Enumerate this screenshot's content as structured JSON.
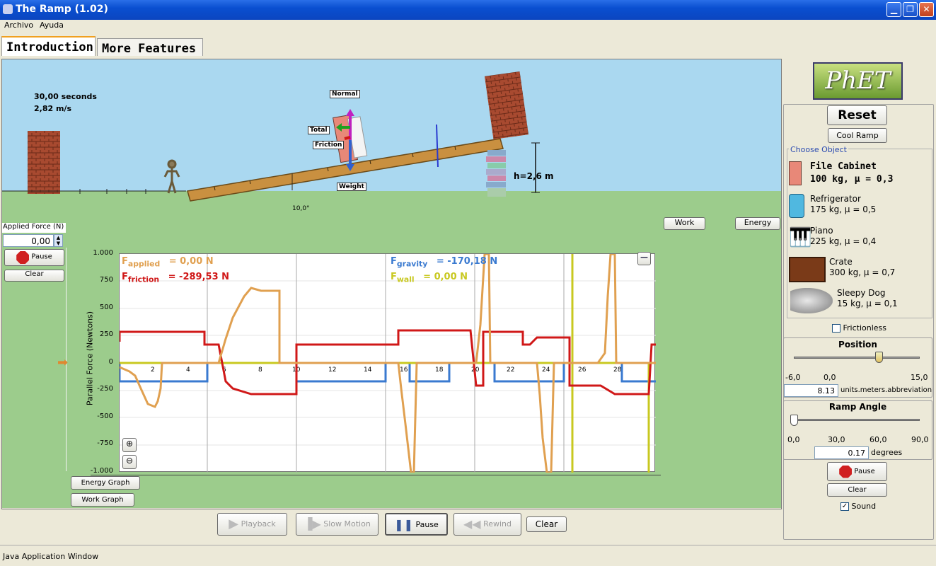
{
  "window": {
    "title": "The Ramp (1.02)",
    "min": "▁",
    "max": "❐",
    "close": "✕"
  },
  "menu": {
    "file": "Archivo",
    "help": "Ayuda"
  },
  "tabs": [
    {
      "label": "Introduction"
    },
    {
      "label": "More Features"
    }
  ],
  "scene": {
    "time": "30,00 seconds",
    "speed": "2,82 m/s",
    "labels": {
      "normal": "Normal",
      "total": "Total",
      "friction": "Friction",
      "weight": "Weight"
    },
    "angle_label": "10,0°",
    "height_label": "h=2,6 m",
    "work_button": "Work",
    "energy_button": "Energy"
  },
  "applied_force": {
    "label": "Applied Force (N)",
    "value": "0,00",
    "pause": "Pause",
    "clear": "Clear"
  },
  "graph": {
    "ylabel": "Parallel Force (Newtons)",
    "yticks": [
      "1.000",
      "750",
      "500",
      "250",
      "0",
      "-250",
      "-500",
      "-750",
      "-1.000"
    ],
    "xticks": [
      "2",
      "4",
      "6",
      "8",
      "10",
      "12",
      "14",
      "16",
      "18",
      "20",
      "22",
      "24",
      "26",
      "28"
    ],
    "f_applied": {
      "sym": "F",
      "sub": "applied",
      "val": "= 0,00 N"
    },
    "f_friction": {
      "sym": "F",
      "sub": "friction",
      "val": "= -289,53 N"
    },
    "f_gravity": {
      "sym": "F",
      "sub": "gravity",
      "val": "= -170,18 N"
    },
    "f_wall": {
      "sym": "F",
      "sub": "wall",
      "val": "= 0,00 N"
    },
    "minimize": "—",
    "energy_graph": "Energy Graph",
    "work_graph": "Work Graph"
  },
  "colors": {
    "applied": "#e0a050",
    "friction": "#d01818",
    "gravity": "#3a7ad0",
    "wall": "#c8c820"
  },
  "playback": {
    "playback": "Playback",
    "slow": "Slow Motion",
    "pause": "Pause",
    "rewind": "Rewind",
    "clear": "Clear"
  },
  "right": {
    "logo": "PhET",
    "reset": "Reset",
    "cool_ramp": "Cool Ramp",
    "choose_object": "Choose Object",
    "objects": [
      {
        "name": "File Cabinet",
        "desc": "100 kg, μ = 0,3",
        "icon": "file-cabinet-icon"
      },
      {
        "name": "Refrigerator",
        "desc": "175 kg, μ = 0,5",
        "icon": "refrigerator-icon"
      },
      {
        "name": "Piano",
        "desc": "225 kg, μ = 0,4",
        "icon": "piano-icon"
      },
      {
        "name": "Crate",
        "desc": "300 kg, μ = 0,7",
        "icon": "crate-icon"
      },
      {
        "name": "Sleepy Dog",
        "desc": "15 kg, μ = 0,1",
        "icon": "dog-icon"
      }
    ],
    "frictionless": "Frictionless",
    "position": {
      "title": "Position",
      "min": "-6,0",
      "mid": "0,0",
      "max": "15,0",
      "value": "8.13",
      "unit": "units.meters.abbreviation"
    },
    "ramp_angle": {
      "title": "Ramp Angle",
      "t0": "0,0",
      "t1": "30,0",
      "t2": "60,0",
      "t3": "90,0",
      "value": "0.17",
      "unit": "degrees"
    },
    "pause": "Pause",
    "clear": "Clear",
    "sound": "Sound"
  },
  "status": "Java Application Window"
}
